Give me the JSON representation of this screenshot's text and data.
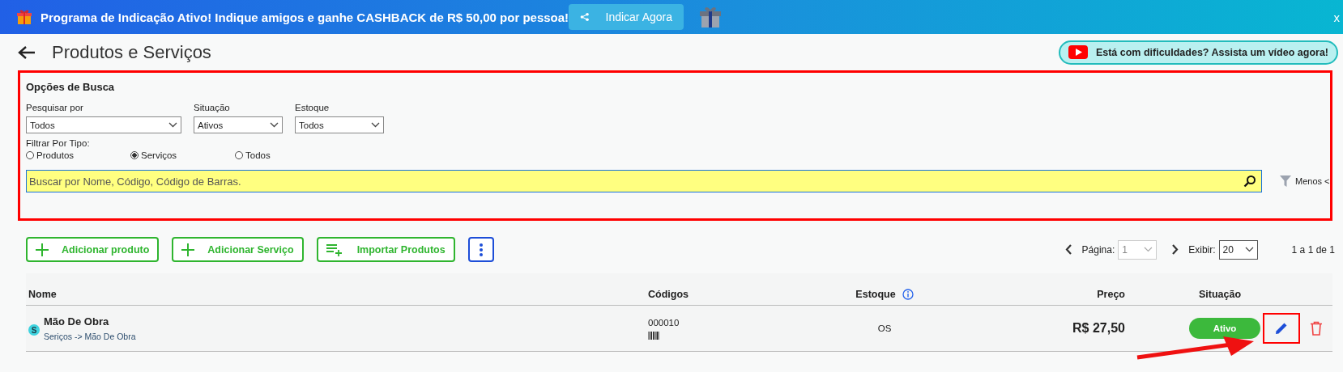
{
  "banner": {
    "message": "Programa de Indicação Ativo! Indique amigos e ganhe CASHBACK de R$ 50,00 por pessoa!",
    "button": "Indicar Agora",
    "close": "x"
  },
  "header": {
    "title": "Produtos e Serviços",
    "help_button": "Está com dificuldades? Assista um vídeo agora!"
  },
  "search_options": {
    "title": "Opções de Busca",
    "selects": [
      {
        "label": "Pesquisar por",
        "value": "Todos"
      },
      {
        "label": "Situação",
        "value": "Ativos"
      },
      {
        "label": "Estoque",
        "value": "Todos"
      }
    ],
    "type_filter": {
      "label": "Filtrar Por Tipo:",
      "options": [
        {
          "label": "Produtos",
          "selected": false
        },
        {
          "label": "Serviços",
          "selected": true
        },
        {
          "label": "Todos",
          "selected": false
        }
      ]
    },
    "search": {
      "placeholder": "Buscar por Nome, Código, Código de Barras."
    },
    "toggle": "Menos <"
  },
  "actions": [
    {
      "label": "Adicionar produto",
      "kind": "add"
    },
    {
      "label": "Adicionar Serviço",
      "kind": "add"
    },
    {
      "label": "Importar Produtos",
      "kind": "import"
    },
    {
      "kind": "more"
    }
  ],
  "pagination": {
    "page_label": "Página:",
    "page": "1",
    "show_label": "Exibir:",
    "per_page": "20",
    "summary": "1 a 1 de 1"
  },
  "table": {
    "columns": [
      "Nome",
      "Códigos",
      "Estoque",
      "Preço",
      "Situação"
    ],
    "rows": [
      {
        "badge": "S",
        "color": "#3fd4e0",
        "name": "Mão De Obra",
        "category": "Seriços -> Mão De Obra",
        "code": "000010",
        "stock": "OS",
        "price": "R$ 27,50",
        "status": "Ativo"
      }
    ]
  }
}
